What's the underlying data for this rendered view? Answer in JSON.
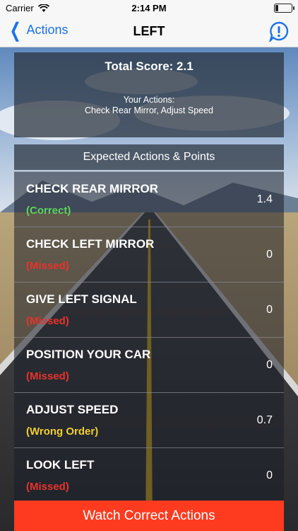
{
  "statusbar": {
    "carrier": "Carrier",
    "time": "2:14 PM"
  },
  "nav": {
    "back_label": "Actions",
    "title": "LEFT"
  },
  "score": {
    "total": "Total Score: 2.1",
    "your_actions_label": "Your Actions:",
    "your_actions": "Check Rear Mirror, Adjust Speed"
  },
  "expected_header": "Expected Actions & Points",
  "rows": [
    {
      "name": "CHECK REAR MIRROR",
      "status": "(Correct)",
      "points": "1.4",
      "status_color": "#5fd35b"
    },
    {
      "name": "CHECK LEFT MIRROR",
      "status": "(Missed)",
      "points": "0",
      "status_color": "#e8332c"
    },
    {
      "name": "GIVE LEFT SIGNAL",
      "status": "(Missed)",
      "points": "0",
      "status_color": "#e8332c"
    },
    {
      "name": "POSITION YOUR CAR",
      "status": "(Missed)",
      "points": "0",
      "status_color": "#e8332c"
    },
    {
      "name": "ADJUST SPEED",
      "status": "(Wrong Order)",
      "points": "0.7",
      "status_color": "#f2cf2b"
    },
    {
      "name": "LOOK LEFT",
      "status": "(Missed)",
      "points": "0",
      "status_color": "#e8332c"
    }
  ],
  "watch_button": "Watch Correct Actions",
  "colors": {
    "accent": "#1a73e8",
    "button": "#ff3b1f"
  }
}
